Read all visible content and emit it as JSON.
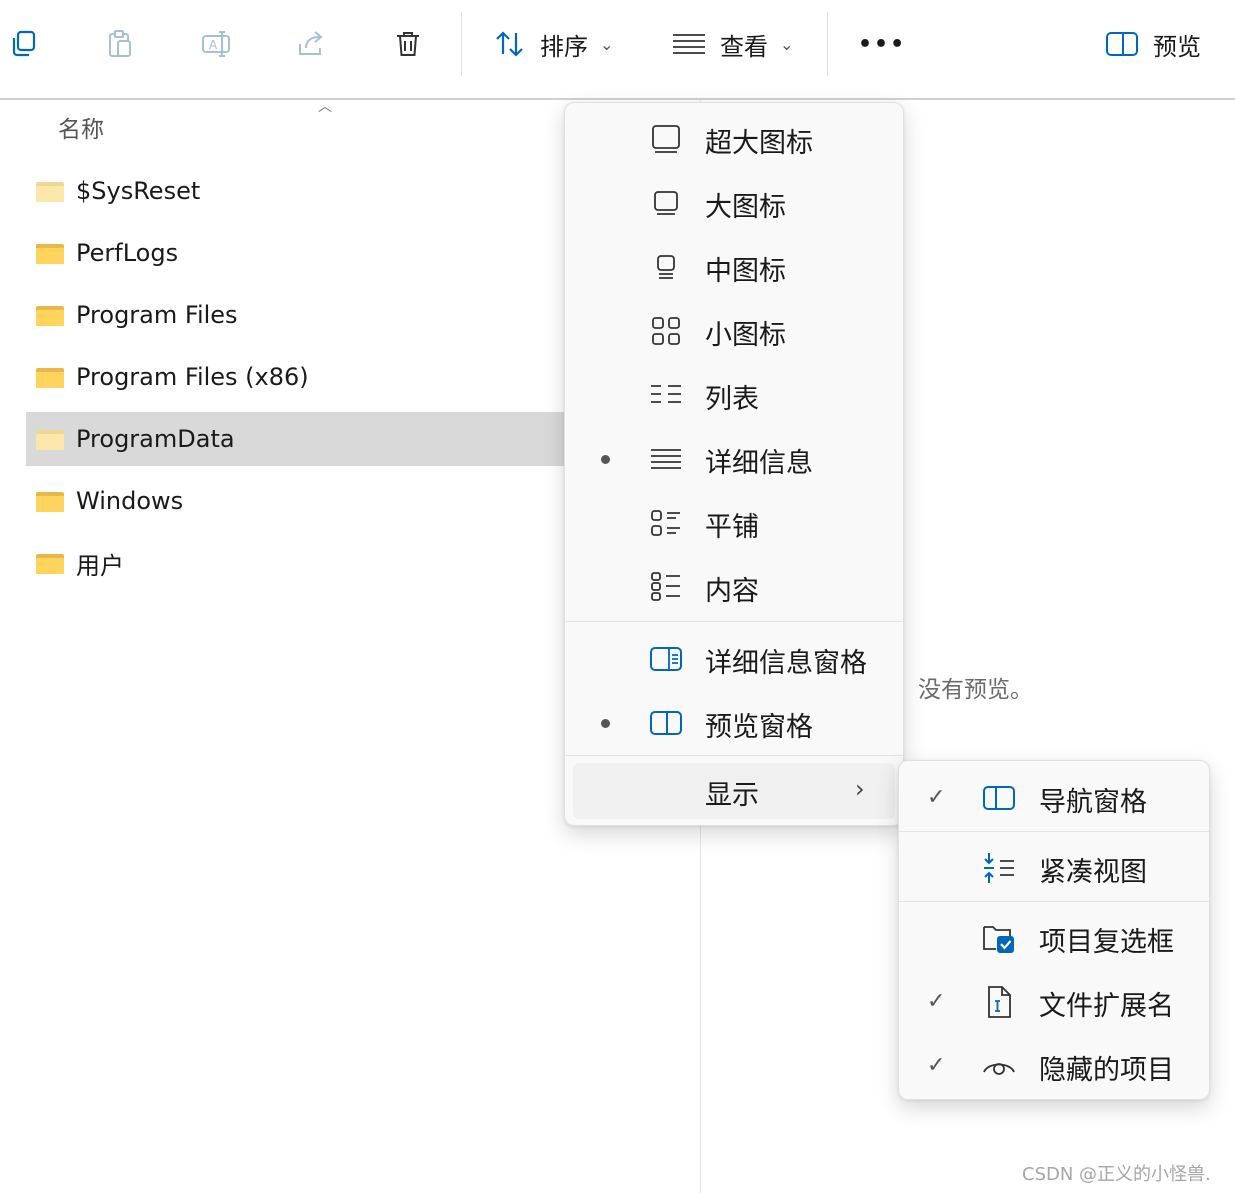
{
  "toolbar": {
    "sort_label": "排序",
    "view_label": "查看",
    "more_label": "•••",
    "preview_label": "预览",
    "icons": [
      "new-icon",
      "paste-icon",
      "rename-icon",
      "share-icon",
      "delete-icon"
    ]
  },
  "file_list": {
    "header_name": "名称",
    "sort_indicator": "^",
    "items": [
      {
        "name": "$SysReset",
        "selected": false,
        "faded": true
      },
      {
        "name": "PerfLogs",
        "selected": false,
        "faded": false
      },
      {
        "name": "Program Files",
        "selected": false,
        "faded": false
      },
      {
        "name": "Program Files (x86)",
        "selected": false,
        "faded": false
      },
      {
        "name": "ProgramData",
        "selected": true,
        "faded": true
      },
      {
        "name": "Windows",
        "selected": false,
        "faded": false
      },
      {
        "name": "用户",
        "selected": false,
        "faded": false
      }
    ]
  },
  "preview_pane": {
    "message": "没有预览。"
  },
  "view_menu": {
    "items": [
      {
        "label": "超大图标",
        "icon": "extra-large-icons-icon",
        "active": false
      },
      {
        "label": "大图标",
        "icon": "large-icons-icon",
        "active": false
      },
      {
        "label": "中图标",
        "icon": "medium-icons-icon",
        "active": false
      },
      {
        "label": "小图标",
        "icon": "small-icons-icon",
        "active": false
      },
      {
        "label": "列表",
        "icon": "list-icon",
        "active": false
      },
      {
        "label": "详细信息",
        "icon": "details-icon",
        "active": true
      },
      {
        "label": "平铺",
        "icon": "tiles-icon",
        "active": false
      },
      {
        "label": "内容",
        "icon": "content-icon",
        "active": false
      }
    ],
    "pane_items": [
      {
        "label": "详细信息窗格",
        "icon": "details-pane-icon",
        "active": false
      },
      {
        "label": "预览窗格",
        "icon": "preview-pane-icon",
        "active": true
      }
    ],
    "show_label": "显示",
    "show_arrow": "›"
  },
  "show_submenu": {
    "items": [
      {
        "label": "导航窗格",
        "icon": "navigation-pane-icon",
        "checked": true
      },
      {
        "label": "紧凑视图",
        "icon": "compact-view-icon",
        "checked": false
      },
      {
        "label": "项目复选框",
        "icon": "item-checkboxes-icon",
        "checked": false
      },
      {
        "label": "文件扩展名",
        "icon": "file-extensions-icon",
        "checked": true
      },
      {
        "label": "隐藏的项目",
        "icon": "hidden-items-icon",
        "checked": true
      }
    ],
    "check_glyph": "✓"
  },
  "watermark": "CSDN @正义的小怪兽."
}
